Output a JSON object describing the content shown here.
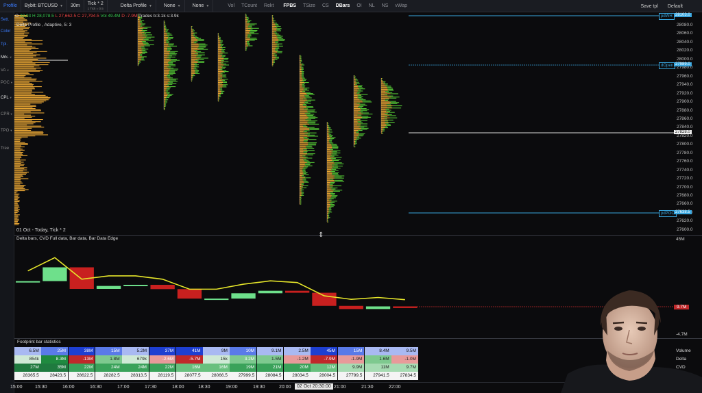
{
  "toolbar": {
    "profile_label": "Profile",
    "exchange_label": "Bybit: BTCUSD",
    "timeframe_label": "30m",
    "tick_label": "Tick * 2",
    "tick_sub": "1 Tick = 0.5",
    "profile_type_label": "Delta Profile",
    "none1_label": "None",
    "none2_label": "None",
    "vol_label": "Vol",
    "tcount_label": "TCount",
    "rekt_label": "Rekt",
    "fpbs_label": "FPBS",
    "tsize_label": "TSize",
    "cs_label": "CS",
    "dbars_label": "DBars",
    "oi_label": "OI",
    "nl_label": "NL",
    "ns_label": "NS",
    "vwap_label": "vWap",
    "save_tpl_label": "Save tpl",
    "default_label": "Default"
  },
  "sidebar": {
    "items": [
      {
        "label": "Sett."
      },
      {
        "label": "Color"
      },
      {
        "label": "Tpl."
      },
      {
        "label": "Mrk."
      },
      {
        "label": "VA"
      },
      {
        "label": "POC"
      },
      {
        "label": "CPL"
      },
      {
        "label": "CPR"
      },
      {
        "label": "TPO"
      },
      {
        "label": "Tree"
      }
    ]
  },
  "info": {
    "open_prefix": "O",
    "open_value": "28,03",
    "high_text": "H 28,078.5",
    "low_text": "L 27,662.5",
    "close_text": "C 27,794.5",
    "vol_text": "Vol 49.4M",
    "delta_text": "D -7.9M",
    "trades_text": "Trades b:3.1k s:3.9k",
    "indicator_label": "Delta Profile , Adaptive, 5: 3",
    "date_label": "01 Oct  - Today, Tick * 2"
  },
  "price_axis": {
    "ticks": [
      "28080.0",
      "28060.0",
      "28040.0",
      "28020.0",
      "28000.0",
      "27980.0",
      "27960.0",
      "27940.0",
      "27920.0",
      "27900.0",
      "27880.0",
      "27860.0",
      "27840.0",
      "27820.0",
      "27800.0",
      "27780.0",
      "27760.0",
      "27740.0",
      "27720.0",
      "27700.0",
      "27680.0",
      "27660.0",
      "27640.0",
      "27620.0",
      "27600.0"
    ],
    "badge_pdwh": "28103.0",
    "badge_dopen": "27989.0",
    "badge_current": "27828.0",
    "badge_pdpoc": "27638.5"
  },
  "levels": {
    "pdwh_label": "pdWH",
    "dopen_label": "dOpen",
    "pdpoc_label": "pdPOC"
  },
  "sub_panel": {
    "title": "Delta bars, CVD Full data, Bar data, Bar Data Edge",
    "axis_top": "45M",
    "axis_mid": "9.7M",
    "axis_bottom": "-4.7M"
  },
  "stats": {
    "title": "Footprint bar statistics",
    "row_labels": [
      "Volume",
      "Delta",
      "CVD"
    ],
    "volume": [
      "6.5M",
      "25M",
      "38M",
      "15M",
      "5.2M",
      "37M",
      "41M",
      "9M",
      "10M",
      "9.1M",
      "2.5M",
      "45M",
      "15M",
      "8.4M",
      "9.5M"
    ],
    "delta": [
      "854k",
      "8.3M",
      "-13M",
      "1.8M",
      "679k",
      "-2.6M",
      "-5.7M",
      "15k",
      "3.2M",
      "1.5M",
      "-1.2M",
      "-7.9M",
      "-1.9M",
      "1.6M",
      "-1.0M"
    ],
    "cvd": [
      "27M",
      "35M",
      "22M",
      "24M",
      "24M",
      "22M",
      "16M",
      "16M",
      "19M",
      "21M",
      "20M",
      "12M",
      "9.9M",
      "11M",
      "9.7M"
    ],
    "price": [
      "28365.5",
      "28423.5",
      "28622.5",
      "28282.5",
      "28313.5",
      "28119.5",
      "28077.5",
      "28066.5",
      "27999.5",
      "28084.5",
      "28034.5",
      "28004.5",
      "27799.5",
      "27941.5",
      "27834.5"
    ]
  },
  "time_axis": {
    "ticks": [
      "15:00",
      "15:30",
      "16:00",
      "16:30",
      "17:00",
      "17:30",
      "18:00",
      "18:30",
      "19:00",
      "19:30",
      "20:00",
      "21:00",
      "21:30",
      "22:00"
    ],
    "cursor_label": "02 Oct 20:30:00"
  },
  "colors": {
    "accent": "#3b7cff",
    "profile_orange": "#e8a634",
    "profile_green": "#52c234",
    "bull": "#6ee08b",
    "bear": "#c8201f",
    "cvd_line": "#e6e62a",
    "level_blue": "#39a7e0",
    "neg_line": "#c0282a"
  }
}
